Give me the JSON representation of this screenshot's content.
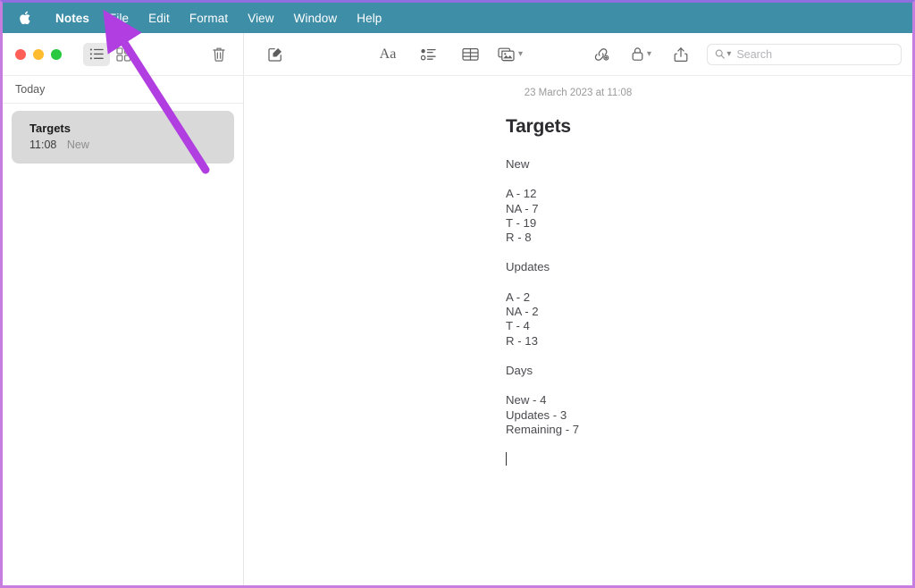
{
  "menubar": {
    "apple_icon": "apple-logo-icon",
    "items": [
      {
        "label": "Notes",
        "bold": true
      },
      {
        "label": "File"
      },
      {
        "label": "Edit"
      },
      {
        "label": "Format"
      },
      {
        "label": "View"
      },
      {
        "label": "Window"
      },
      {
        "label": "Help"
      }
    ],
    "background_color": "#3e8ea8",
    "text_color": "#ffffff"
  },
  "toolbar": {
    "traffic_lights": {
      "close_color": "#ff5f57",
      "minimize_color": "#febc2e",
      "zoom_color": "#28c840"
    },
    "list_view_icon": "list-view-icon",
    "gallery_view_icon": "gallery-view-icon",
    "delete_icon": "trash-icon",
    "compose_icon": "compose-note-icon",
    "format_icon": "format-text-icon",
    "format_label": "Aa",
    "checklist_icon": "checklist-icon",
    "table_icon": "table-icon",
    "media_icon": "media-icon",
    "media_chevron": "chevron-down-icon",
    "link_icon": "collaborate-icon",
    "lock_icon": "lock-icon",
    "lock_chevron": "chevron-down-icon",
    "share_icon": "share-icon",
    "search": {
      "icon": "search-icon",
      "chevron": "chevron-down-icon",
      "placeholder": "Search",
      "value": ""
    }
  },
  "sidebar": {
    "section_header": "Today",
    "notes": [
      {
        "title": "Targets",
        "time": "11:08",
        "preview": "New",
        "selected": true
      }
    ]
  },
  "editor": {
    "date": "23 March 2023 at 11:08",
    "title": "Targets",
    "blocks": [
      {
        "text": "New"
      },
      {
        "text": "A - 12\nNA - 7\nT - 19\nR - 8"
      },
      {
        "text": "Updates"
      },
      {
        "text": "A - 2\nNA - 2\nT - 4\nR - 13"
      },
      {
        "text": "Days"
      },
      {
        "text": "New - 4\nUpdates - 3\nRemaining - 7"
      }
    ]
  },
  "annotation": {
    "arrow_color": "#b13ee0",
    "points_to": "File"
  }
}
